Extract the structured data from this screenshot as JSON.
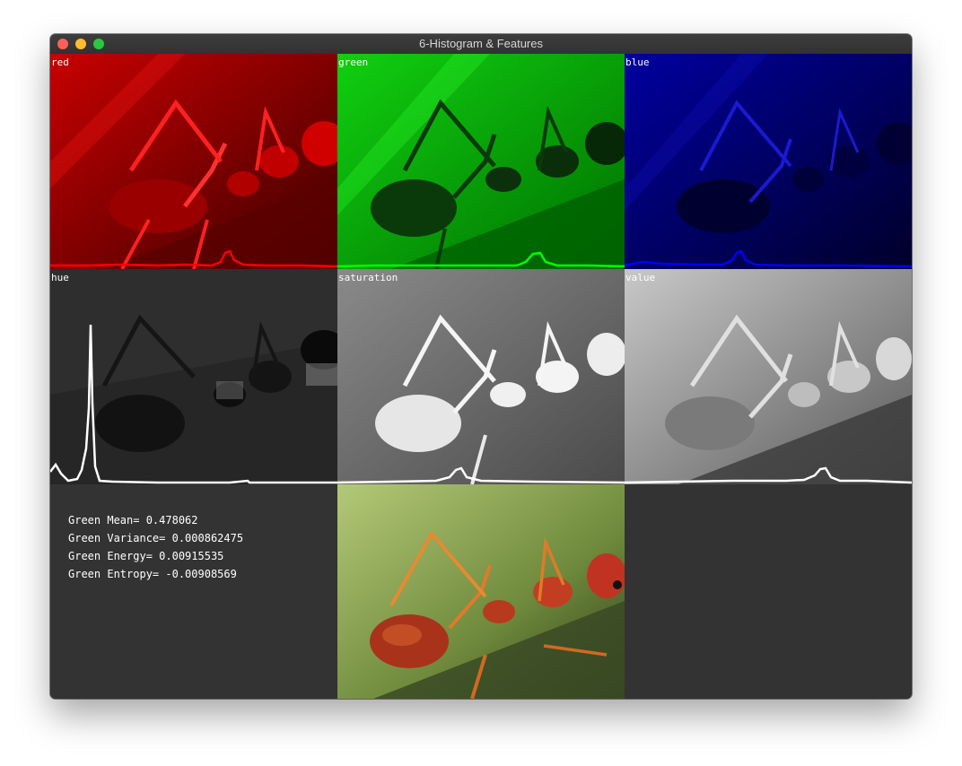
{
  "window": {
    "title": "6-Histogram & Features"
  },
  "panels": {
    "red": "red",
    "green": "green",
    "blue": "blue",
    "hue": "hue",
    "saturation": "saturation",
    "value": "value"
  },
  "features": {
    "mean": "Green Mean= 0.478062",
    "variance": "Green Variance= 0.000862475",
    "energy": "Green Energy= 0.00915535",
    "entropy": "Green Entropy= -0.00908569"
  },
  "colors": {
    "red_channel": "#ff0000",
    "green_channel": "#00ff00",
    "blue_channel": "#0000ff",
    "histogram_gray": "#ffffff",
    "background": "#333333"
  }
}
